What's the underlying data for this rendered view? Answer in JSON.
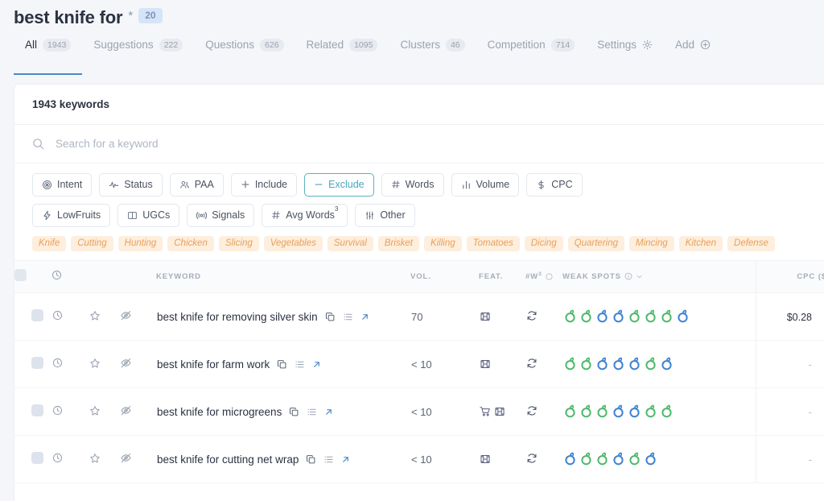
{
  "header": {
    "title": "best knife for",
    "asterisk": "*",
    "badge": "20",
    "tabs": [
      {
        "label": "All",
        "count": "1943",
        "active": true
      },
      {
        "label": "Suggestions",
        "count": "222",
        "active": false
      },
      {
        "label": "Questions",
        "count": "626",
        "active": false
      },
      {
        "label": "Related",
        "count": "1095",
        "active": false
      },
      {
        "label": "Clusters",
        "count": "46",
        "active": false
      },
      {
        "label": "Competition",
        "count": "714",
        "active": false
      },
      {
        "label": "Settings",
        "icon": "gear-icon",
        "active": false
      },
      {
        "label": "Add",
        "icon": "plus-circle-icon",
        "active": false
      }
    ]
  },
  "card": {
    "heading": "1943 keywords",
    "search": {
      "placeholder": "Search for a keyword",
      "value": "",
      "icon": "search-icon"
    }
  },
  "filters": {
    "row1": [
      {
        "label": "Intent",
        "icon": "target-icon",
        "selected": false
      },
      {
        "label": "Status",
        "icon": "pulse-icon",
        "selected": false
      },
      {
        "label": "PAA",
        "icon": "people-icon",
        "selected": false
      },
      {
        "label": "Include",
        "icon": "plus-icon",
        "selected": false
      },
      {
        "label": "Exclude",
        "icon": "minus-icon",
        "selected": true
      },
      {
        "label": "Words",
        "icon": "hash-icon",
        "selected": false
      },
      {
        "label": "Volume",
        "icon": "bars-icon",
        "selected": false
      },
      {
        "label": "CPC",
        "icon": "dollar-icon",
        "selected": false
      }
    ],
    "row2": [
      {
        "label": "LowFruits",
        "icon": "bolt-icon",
        "selected": false
      },
      {
        "label": "UGCs",
        "icon": "book-icon",
        "selected": false
      },
      {
        "label": "Signals",
        "icon": "signal-icon",
        "selected": false
      },
      {
        "label": "Avg Words",
        "icon": "hash-icon",
        "sup": "3",
        "selected": false
      },
      {
        "label": "Other",
        "icon": "sliders-icon",
        "selected": false
      }
    ]
  },
  "tags": [
    "Knife",
    "Cutting",
    "Hunting",
    "Chicken",
    "Slicing",
    "Vegetables",
    "Survival",
    "Brisket",
    "Killing",
    "Tomatoes",
    "Dicing",
    "Quartering",
    "Mincing",
    "Kitchen",
    "Defense"
  ],
  "table": {
    "columns": {
      "check": "",
      "clock": "clock-icon",
      "keyword": "KEYWORD",
      "vol": "VOL.",
      "feat": "FEAT.",
      "words": "#W",
      "words_sup": "3",
      "weak": "WEAK SPOTS",
      "cpc": "CPC ($)"
    },
    "rows": [
      {
        "keyword": "best knife for removing silver skin",
        "vol": "70",
        "feat": [
          "image-pack-icon"
        ],
        "words": "refresh-icon",
        "weak": [
          "g",
          "g",
          "b",
          "b",
          "g",
          "g",
          "g",
          "b"
        ],
        "cpc": "$0.28"
      },
      {
        "keyword": "best knife for farm work",
        "vol": "< 10",
        "feat": [
          "image-pack-icon"
        ],
        "words": "refresh-icon",
        "weak": [
          "g",
          "g",
          "b",
          "b",
          "b",
          "g",
          "b"
        ],
        "cpc": "-"
      },
      {
        "keyword": "best knife for microgreens",
        "vol": "< 10",
        "feat": [
          "shopping-cart-icon",
          "image-pack-icon"
        ],
        "words": "refresh-icon",
        "weak": [
          "g",
          "g",
          "g",
          "b",
          "b",
          "g",
          "g"
        ],
        "cpc": "-"
      },
      {
        "keyword": "best knife for cutting net wrap",
        "vol": "< 10",
        "feat": [
          "image-pack-icon"
        ],
        "words": "refresh-icon",
        "weak": [
          "b",
          "g",
          "g",
          "b",
          "g",
          "b"
        ],
        "cpc": "-"
      }
    ]
  },
  "colors": {
    "accent_blue": "#4a89c8",
    "selected_chip": "#4aa7bb",
    "tag_text": "#e8a05a",
    "tag_bg": "#fdeedd",
    "fruit_green": "#4cb96a",
    "fruit_blue": "#3d82d4"
  }
}
